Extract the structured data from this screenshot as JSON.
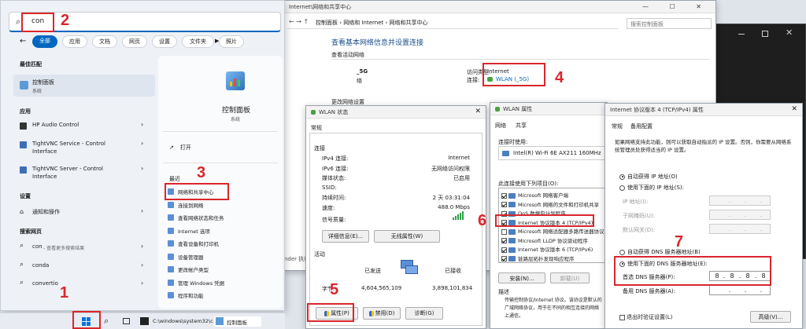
{
  "search": {
    "query": "con",
    "filters": [
      "全部",
      "应用",
      "文档",
      "网页",
      "设置",
      "文件夹",
      "照片"
    ],
    "best_match_heading": "最佳匹配",
    "best_match": {
      "name": "控制面板",
      "sub": "系统"
    },
    "apps_heading": "应用",
    "apps": [
      {
        "name": "HP Audio Control",
        "sub": ""
      },
      {
        "name": "TightVNC Service - Control",
        "sub": "Interface"
      },
      {
        "name": "TightVNC Server - Control",
        "sub": "Interface"
      }
    ],
    "settings_heading": "设置",
    "settings": [
      {
        "name": "通知和操作"
      }
    ],
    "web_heading": "搜索网页",
    "web": [
      {
        "name": "con",
        "sub": " - 查看更多搜索结果"
      },
      {
        "name": "conda"
      },
      {
        "name": "convertio"
      }
    ],
    "detail": {
      "title": "控制面板",
      "sub": "系统",
      "open": "打开",
      "recent_heading": "最近",
      "recent": [
        "网络和共享中心",
        "连接到网络",
        "查看网络状态和任务",
        "Internet 选项",
        "查看设备和打印机",
        "设备管理器",
        "更改帐户类型",
        "管理 Windows 凭据",
        "程序和功能"
      ]
    }
  },
  "taskbar": {
    "cmd": "C:\\windows\\system32\\c",
    "cp": "控制面板"
  },
  "nsc": {
    "title": "Internet\\网络和共享中心",
    "crumb": "控制面板 › 网络和 Internet › 网络和共享中心",
    "search_placeholder": "搜索控制面板",
    "heading": "查看基本网络信息并设置连接",
    "active_label": "查看活动网络",
    "network_name": "_5G",
    "network_type": "络",
    "access_label": "访问类型:",
    "access_value": "Internet",
    "conn_label": "连接:",
    "conn_value": "WLAN (_5G)",
    "change_label": "更改网络设置",
    "under": "nder 执行"
  },
  "wlan_status": {
    "title": "WLAN 状态",
    "tab": "常规",
    "conn_heading": "连接",
    "rows": [
      {
        "k": "IPv4 连接:",
        "v": "Internet"
      },
      {
        "k": "IPv6 连接:",
        "v": "无网络访问权限"
      },
      {
        "k": "媒体状态:",
        "v": "已启用"
      },
      {
        "k": "SSID:",
        "v": ""
      },
      {
        "k": "持续时间:",
        "v": "2 天 03:31:04"
      },
      {
        "k": "速度:",
        "v": "488.0 Mbps"
      }
    ],
    "signal_label": "信号质量:",
    "details_btn": "详细信息(E)...",
    "wireless_btn": "无线属性(W)",
    "activity_heading": "活动",
    "sent_label": "已发送",
    "recv_label": "已接收",
    "bytes_label": "字节:",
    "bytes_sent": "4,604,565,109",
    "bytes_recv": "3,898,101,834",
    "props_btn": "属性(P)",
    "disable_btn": "禁用(D)",
    "diag_btn": "诊断(G)"
  },
  "wlan_props": {
    "title": "WLAN 属性",
    "tabs": [
      "网络",
      "共享"
    ],
    "connect_using": "连接时使用:",
    "adapter": "Intel(R) Wi-Fi 6E AX211 160MHz",
    "items_label": "此连接使用下列项目(O):",
    "items": [
      {
        "name": "Microsoft 网络客户端",
        "checked": true
      },
      {
        "name": "Microsoft 网络的文件和打印机共享",
        "checked": true
      },
      {
        "name": "QoS 数据包计划程序",
        "checked": true
      },
      {
        "name": "Internet 协议版本 4 (TCP/IPv4)",
        "checked": true
      },
      {
        "name": "Microsoft 网络适配器多路传送器协议",
        "checked": false
      },
      {
        "name": "Microsoft LLDP 协议驱动程序",
        "checked": true
      },
      {
        "name": "Internet 协议版本 6 (TCP/IPv6)",
        "checked": true
      },
      {
        "name": "链路层拓扑发现响应程序",
        "checked": true
      }
    ],
    "install_btn": "安装(N)...",
    "uninstall_btn": "卸载(U)",
    "desc_heading": "描述",
    "desc": "传输控制协议/Internet 协议。该协议是默认的广域网络协议，用于在不同的相互连接的网络上通信。"
  },
  "ipv4": {
    "title": "Internet 协议版本 4 (TCP/IPv4) 属性",
    "tabs": [
      "常规",
      "备用配置"
    ],
    "intro": "如果网络支持此功能，则可以获取自动指派的 IP 设置。否则，你需要从网络系统管理员处获得适当的 IP 设置。",
    "auto_ip": "自动获得 IP 地址(O)",
    "manual_ip": "使用下面的 IP 地址(S):",
    "ip_label": "IP 地址(I):",
    "mask_label": "子网掩码(U):",
    "gw_label": "默认网关(D):",
    "auto_dns": "自动获得 DNS 服务器地址(B)",
    "manual_dns": "使用下面的 DNS 服务器地址(E):",
    "pref_dns_label": "首选 DNS 服务器(P):",
    "pref_dns": [
      "8",
      "8",
      "8",
      "8"
    ],
    "alt_dns_label": "备用 DNS 服务器(A):",
    "validate": "退出时验证设置(L)",
    "advanced_btn": "高级(V)..."
  },
  "annotations": [
    "1",
    "2",
    "3",
    "4",
    "5",
    "6",
    "7"
  ],
  "colors": {
    "accent": "#0067c0",
    "red": "#d9262c"
  }
}
